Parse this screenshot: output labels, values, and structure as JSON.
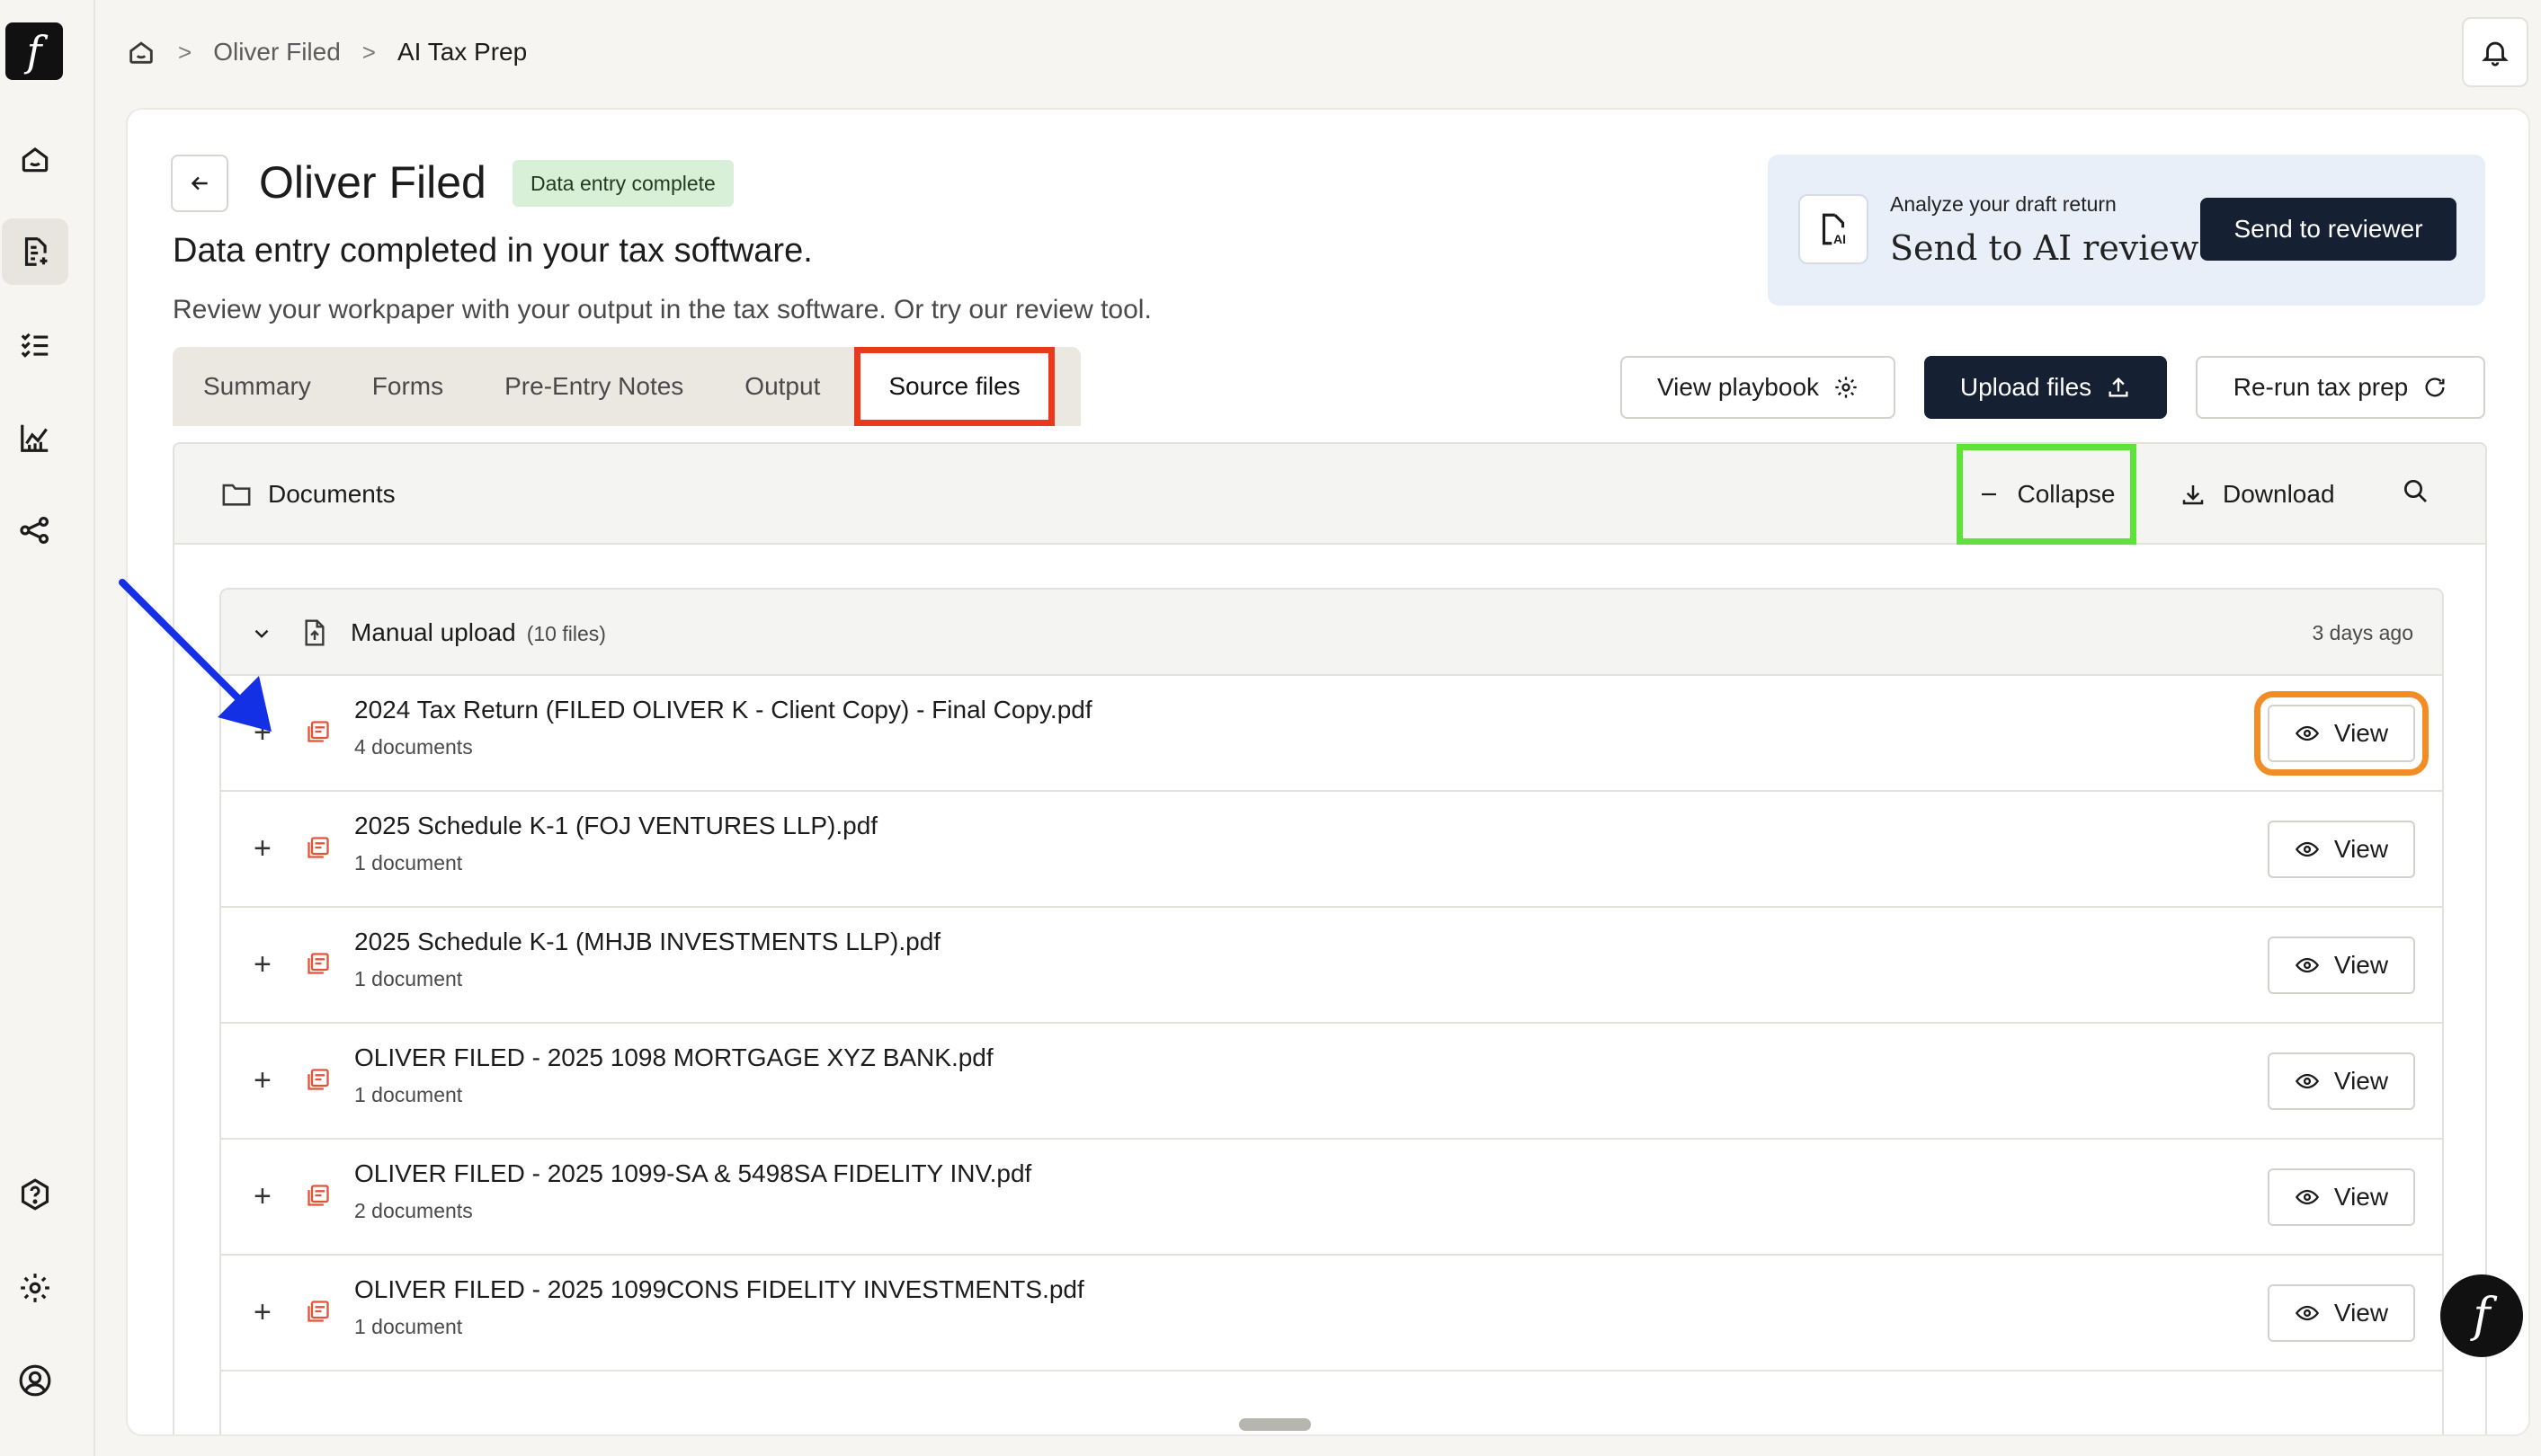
{
  "app": {
    "logo_glyph": "f",
    "fab_glyph": "f"
  },
  "breadcrumb": {
    "items": [
      "Oliver Filed",
      "AI Tax Prep"
    ],
    "separator": ">"
  },
  "sidebar": {
    "items": [
      {
        "name": "home-icon"
      },
      {
        "name": "tax-document-icon",
        "active": true
      },
      {
        "name": "checklist-icon"
      },
      {
        "name": "analytics-icon"
      },
      {
        "name": "share-icon"
      },
      {
        "name": "help-icon"
      },
      {
        "name": "settings-icon"
      },
      {
        "name": "profile-icon"
      }
    ]
  },
  "header": {
    "client_name": "Oliver Filed",
    "status_badge": "Data entry complete",
    "headline": "Data entry completed in your tax software.",
    "subline": "Review your workpaper with your output in the tax software. Or try our review tool."
  },
  "ai_review": {
    "label": "Analyze your draft return",
    "title": "Send to AI review",
    "button": "Send to reviewer"
  },
  "tabs": [
    "Summary",
    "Forms",
    "Pre-Entry Notes",
    "Output",
    "Source files"
  ],
  "active_tab": "Source files",
  "actions": {
    "playbook": "View playbook",
    "upload": "Upload files",
    "rerun": "Re-run tax prep"
  },
  "documents": {
    "title": "Documents",
    "collapse": "Collapse",
    "download": "Download",
    "group": {
      "title": "Manual upload",
      "count": "(10 files)",
      "time": "3 days ago"
    },
    "view_label": "View",
    "files": [
      {
        "name": "2024 Tax Return (FILED OLIVER K - Client Copy) - Final Copy.pdf",
        "sub": "4 documents"
      },
      {
        "name": "2025 Schedule K-1 (FOJ VENTURES LLP).pdf",
        "sub": "1 document"
      },
      {
        "name": "2025 Schedule K-1 (MHJB INVESTMENTS LLP).pdf",
        "sub": "1 document"
      },
      {
        "name": "OLIVER FILED - 2025 1098 MORTGAGE XYZ BANK.pdf",
        "sub": "1 document"
      },
      {
        "name": "OLIVER FILED - 2025 1099-SA & 5498SA FIDELITY INV.pdf",
        "sub": "2 documents"
      },
      {
        "name": "OLIVER FILED - 2025 1099CONS FIDELITY INVESTMENTS.pdf",
        "sub": "1 document"
      }
    ]
  },
  "colors": {
    "navy": "#162033",
    "badge_green": "#d9f0d8",
    "pdf_red": "#e0553a",
    "highlight_red": "#e8391d",
    "highlight_green": "#5fe13c",
    "highlight_orange": "#f28c25",
    "arrow_blue": "#1430e6"
  }
}
